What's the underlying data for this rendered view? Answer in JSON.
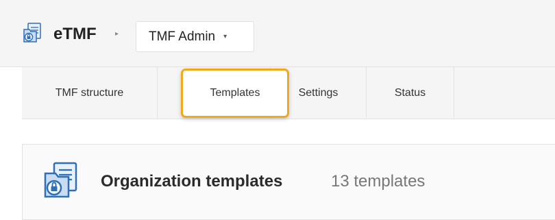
{
  "header": {
    "app_name": "eTMF",
    "app_icon": "etmf-folder-lock-icon",
    "breadcrumb_separator": "▸",
    "context_dropdown": {
      "selected": "TMF Admin",
      "caret": "▾"
    }
  },
  "tabs": [
    {
      "label": "TMF structure",
      "active": false
    },
    {
      "label": "Templates",
      "active": true
    },
    {
      "label": "Settings",
      "active": false
    },
    {
      "label": "Status",
      "active": false
    }
  ],
  "section": {
    "icon": "templates-folder-lock-icon",
    "title": "Organization templates",
    "count": "13 templates"
  },
  "colors": {
    "highlight": "#f0a81c",
    "icon_blue": "#2f6fb6",
    "bar_bg": "#f5f5f5"
  }
}
